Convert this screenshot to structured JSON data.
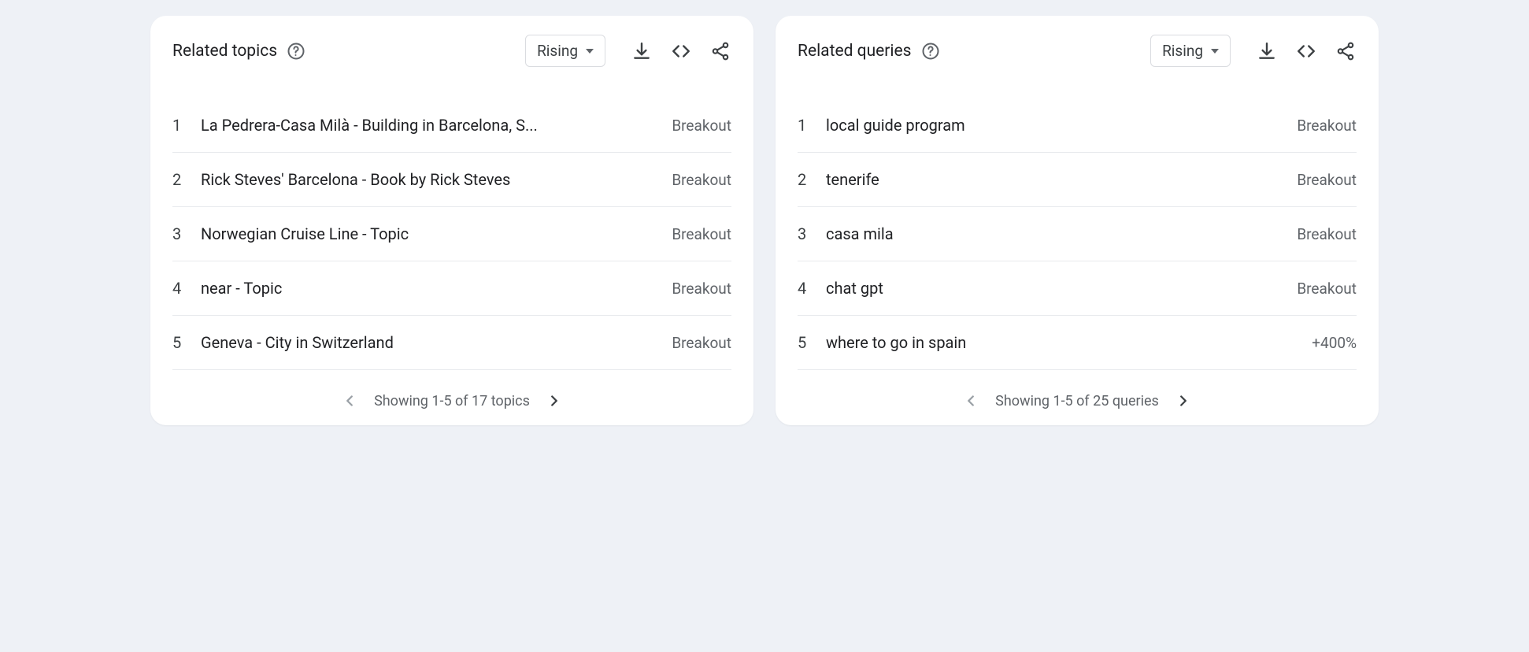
{
  "topics": {
    "title": "Related topics",
    "sort_label": "Rising",
    "pager_text": "Showing 1-5 of 17 topics",
    "rows": [
      {
        "rank": "1",
        "label": "La Pedrera-Casa Milà - Building in Barcelona, S...",
        "metric": "Breakout"
      },
      {
        "rank": "2",
        "label": "Rick Steves' Barcelona - Book by Rick Steves",
        "metric": "Breakout"
      },
      {
        "rank": "3",
        "label": "Norwegian Cruise Line - Topic",
        "metric": "Breakout"
      },
      {
        "rank": "4",
        "label": "near - Topic",
        "metric": "Breakout"
      },
      {
        "rank": "5",
        "label": "Geneva - City in Switzerland",
        "metric": "Breakout"
      }
    ]
  },
  "queries": {
    "title": "Related queries",
    "sort_label": "Rising",
    "pager_text": "Showing 1-5 of 25 queries",
    "rows": [
      {
        "rank": "1",
        "label": "local guide program",
        "metric": "Breakout"
      },
      {
        "rank": "2",
        "label": "tenerife",
        "metric": "Breakout"
      },
      {
        "rank": "3",
        "label": "casa mila",
        "metric": "Breakout"
      },
      {
        "rank": "4",
        "label": "chat gpt",
        "metric": "Breakout"
      },
      {
        "rank": "5",
        "label": "where to go in spain",
        "metric": "+400%"
      }
    ]
  }
}
